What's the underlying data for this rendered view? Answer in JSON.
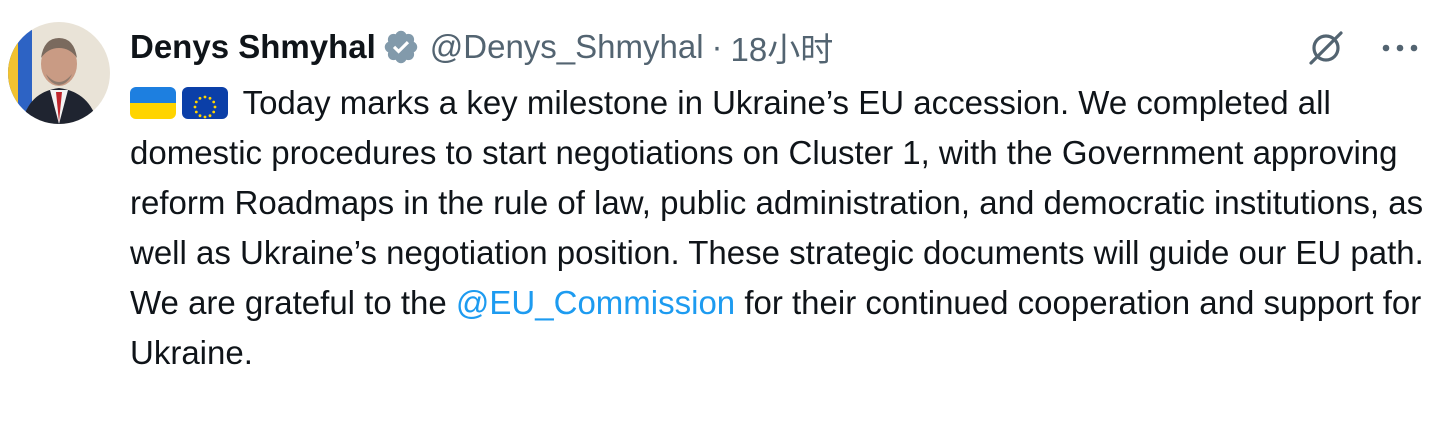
{
  "author": {
    "name": "Denys Shmyhal",
    "handle": "@Denys_Shmyhal",
    "separator": "·",
    "time": "18小时"
  },
  "tweet": {
    "text_before": "Today marks a key milestone in Ukraine’s EU accession. We completed all domestic procedures to start negotiations on Cluster 1, with the Government approving reform Roadmaps in the rule of law, public administration, and democratic institutions, as well as Ukraine’s negotiation position. These strategic documents will guide our EU path. We are grateful to the ",
    "mention": "@EU_Commission",
    "text_after": " for their continued cooperation and support for Ukraine.",
    "emoji": [
      "ukraine-flag",
      "eu-flag"
    ]
  },
  "colors": {
    "text": "#0f1419",
    "secondary": "#536471",
    "link": "#1d9bf0",
    "verified_badge": "#829aab"
  },
  "icons": [
    "verified-badge-icon",
    "grok-icon",
    "more-icon"
  ]
}
